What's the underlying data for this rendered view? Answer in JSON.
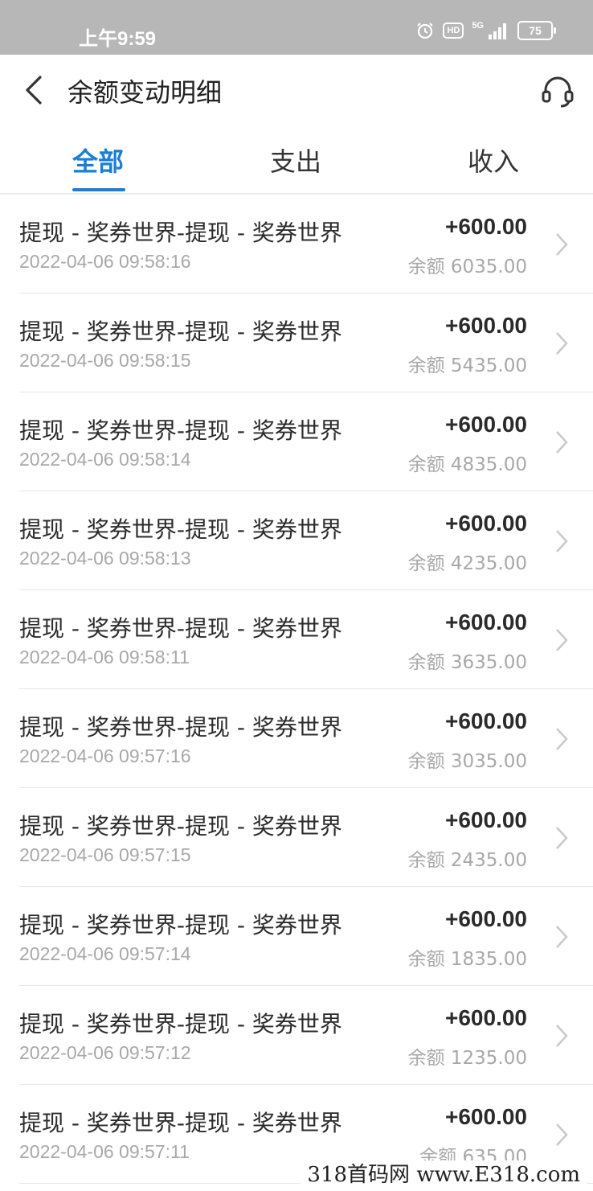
{
  "status_bar": {
    "time": "上午9:59",
    "hd": "HD",
    "network": "5G",
    "battery": "75",
    "icons": [
      "alarm-icon",
      "signal-icon",
      "battery-icon"
    ]
  },
  "header": {
    "title": "余额变动明细",
    "back_icon": "chevron-left-icon",
    "support_icon": "headset-icon"
  },
  "tabs": [
    {
      "label": "全部",
      "active": true
    },
    {
      "label": "支出",
      "active": false
    },
    {
      "label": "收入",
      "active": false
    }
  ],
  "accent_color": "#1a7fd4",
  "transactions": [
    {
      "title": "提现 - 奖券世界-提现 - 奖券世界",
      "time": "2022-04-06 09:58:16",
      "amount": "+600.00",
      "balance": "余额 6035.00"
    },
    {
      "title": "提现 - 奖券世界-提现 - 奖券世界",
      "time": "2022-04-06 09:58:15",
      "amount": "+600.00",
      "balance": "余额 5435.00"
    },
    {
      "title": "提现 - 奖券世界-提现 - 奖券世界",
      "time": "2022-04-06 09:58:14",
      "amount": "+600.00",
      "balance": "余额 4835.00"
    },
    {
      "title": "提现 - 奖券世界-提现 - 奖券世界",
      "time": "2022-04-06 09:58:13",
      "amount": "+600.00",
      "balance": "余额 4235.00"
    },
    {
      "title": "提现 - 奖券世界-提现 - 奖券世界",
      "time": "2022-04-06 09:58:11",
      "amount": "+600.00",
      "balance": "余额 3635.00"
    },
    {
      "title": "提现 - 奖券世界-提现 - 奖券世界",
      "time": "2022-04-06 09:57:16",
      "amount": "+600.00",
      "balance": "余额 3035.00"
    },
    {
      "title": "提现 - 奖券世界-提现 - 奖券世界",
      "time": "2022-04-06 09:57:15",
      "amount": "+600.00",
      "balance": "余额 2435.00"
    },
    {
      "title": "提现 - 奖券世界-提现 - 奖券世界",
      "time": "2022-04-06 09:57:14",
      "amount": "+600.00",
      "balance": "余额 1835.00"
    },
    {
      "title": "提现 - 奖券世界-提现 - 奖券世界",
      "time": "2022-04-06 09:57:12",
      "amount": "+600.00",
      "balance": "余额 1235.00"
    },
    {
      "title": "提现 - 奖券世界-提现 - 奖券世界",
      "time": "2022-04-06 09:57:11",
      "amount": "+600.00",
      "balance": "余额 635.00"
    }
  ],
  "watermark": "318首码网  www.E318.com"
}
